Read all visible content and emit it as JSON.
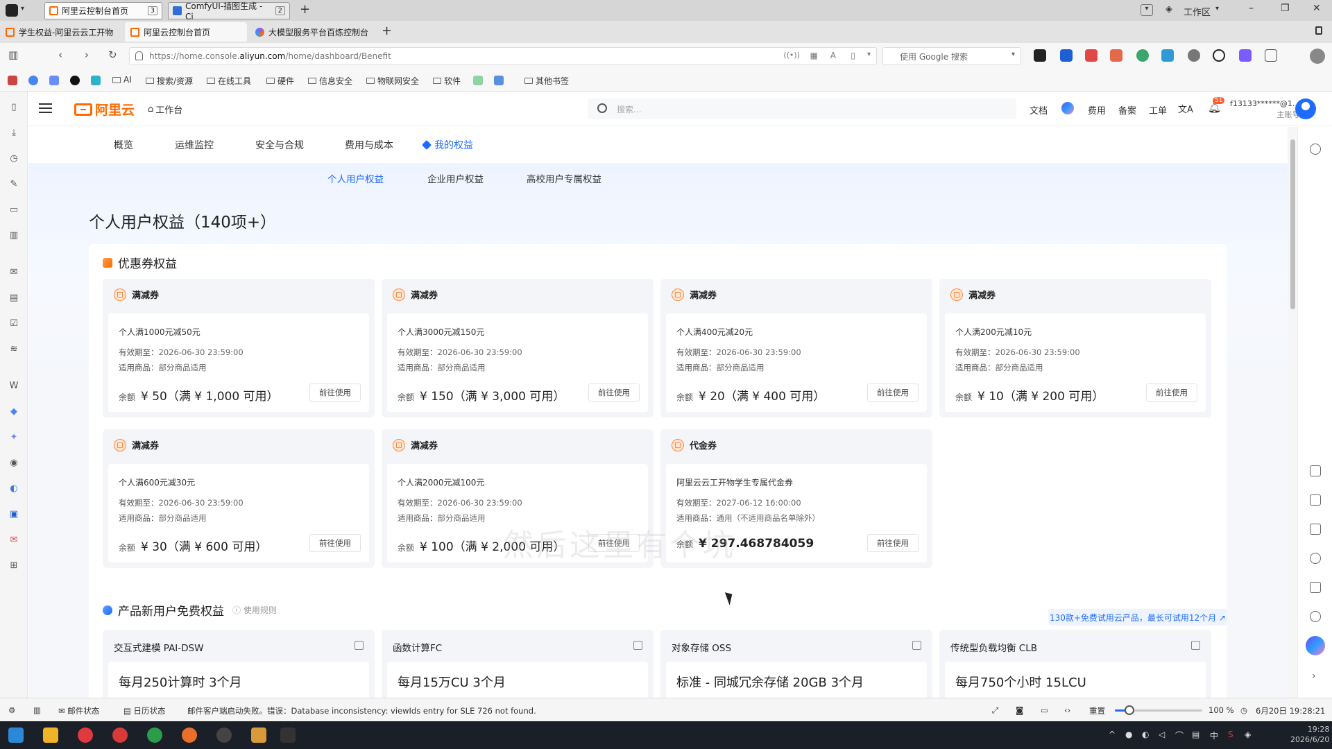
{
  "window_tabs": [
    {
      "label": "阿里云控制台首页",
      "count": "3"
    },
    {
      "label": "ComfyUI-插图生成 - Ci",
      "count": "2"
    }
  ],
  "page_tabs": [
    {
      "label": "学生权益-阿里云云工开物"
    },
    {
      "label": "阿里云控制台首页"
    },
    {
      "label": "大模型服务平台百炼控制台"
    }
  ],
  "workspace_label": "工作区",
  "address": {
    "prefix": "https://home.console.",
    "domain": "aliyun.com",
    "path": "/home/dashboard/Benefit"
  },
  "search_engine_placeholder": "使用 Google 搜索",
  "bookmarks": [
    "AI",
    "搜索/资源",
    "在线工具",
    "硬件",
    "信息安全",
    "物联网安全",
    "软件",
    "其他书签"
  ],
  "app": {
    "logo_text": "阿里云",
    "workbench": "工作台",
    "search_placeholder": "搜索...",
    "header_links": [
      "文档",
      "费用",
      "备案",
      "工单"
    ],
    "notification_count": "51",
    "account_name": "f13133******@1...",
    "account_role": "主账号"
  },
  "nav": [
    "概览",
    "运维监控",
    "安全与合规",
    "费用与成本",
    "我的权益"
  ],
  "subtabs": [
    "个人用户权益",
    "企业用户权益",
    "高校用户专属权益"
  ],
  "page_title": "个人用户权益（140项+）",
  "coupon_section": {
    "title": "优惠券权益",
    "labels": {
      "validity": "有效期至：",
      "applicable": "适用商品：",
      "balance": "余额",
      "use_button": "前往使用"
    },
    "coupons": [
      {
        "type": "满减券",
        "name": "个人满1000元减50元",
        "validity": "2026-06-30 23:59:00",
        "applicable": "部分商品适用",
        "amount": "¥ 50（满 ¥ 1,000 可用）"
      },
      {
        "type": "满减券",
        "name": "个人满3000元减150元",
        "validity": "2026-06-30 23:59:00",
        "applicable": "部分商品适用",
        "amount": "¥ 150（满 ¥ 3,000 可用）"
      },
      {
        "type": "满减券",
        "name": "个人满400元减20元",
        "validity": "2026-06-30 23:59:00",
        "applicable": "部分商品适用",
        "amount": "¥ 20（满 ¥ 400 可用）"
      },
      {
        "type": "满减券",
        "name": "个人满200元减10元",
        "validity": "2026-06-30 23:59:00",
        "applicable": "部分商品适用",
        "amount": "¥ 10（满 ¥ 200 可用）"
      },
      {
        "type": "满减券",
        "name": "个人满600元减30元",
        "validity": "2026-06-30 23:59:00",
        "applicable": "部分商品适用",
        "amount": "¥ 30（满 ¥ 600 可用）"
      },
      {
        "type": "满减券",
        "name": "个人满2000元减100元",
        "validity": "2026-06-30 23:59:00",
        "applicable": "部分商品适用",
        "amount": "¥ 100（满 ¥ 2,000 可用）"
      },
      {
        "type": "代金券",
        "name": "阿里云云工开物学生专属代金券",
        "validity": "2027-06-12 16:00:00",
        "applicable": "通用（不适用商品名单除外）",
        "amount": "¥ 297.468784059"
      }
    ]
  },
  "free_section": {
    "title": "产品新用户免费权益",
    "rule_link": "使用规则",
    "more_link": "130款+免费试用云产品，最长可试用12个月 ↗",
    "products": [
      {
        "name": "交互式建模 PAI-DSW",
        "desc": "每月250计算时 3个月"
      },
      {
        "name": "函数计算FC",
        "desc": "每月15万CU 3个月"
      },
      {
        "name": "对象存储 OSS",
        "desc": "标准 - 同城冗余存储 20GB 3个月"
      },
      {
        "name": "传统型负载均衡 CLB",
        "desc": "每月750个小时 15LCU"
      }
    ]
  },
  "watermark": "然后这里有个坑",
  "statusbar": {
    "mail_status": "邮件状态",
    "calendar_status": "日历状态",
    "message": "邮件客户端启动失败。错误：Database inconsistency: viewIds entry for SLE 726 not found.",
    "reset": "重置",
    "zoom": "100 %",
    "zoom_fraction": 0.17,
    "datetime": "6月20日 19:28:21"
  },
  "taskbar": {
    "time": "19:28",
    "date": "2026/6/20",
    "ime": "中"
  }
}
